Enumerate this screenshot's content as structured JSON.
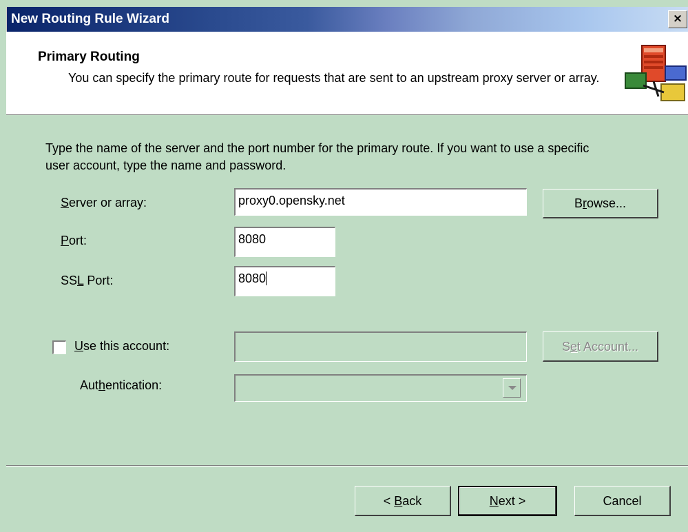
{
  "window": {
    "title": "New Routing Rule Wizard",
    "close_label": "×"
  },
  "header": {
    "title": "Primary Routing",
    "subtitle": "You can specify the primary route for requests that are sent to an upstream proxy server or array."
  },
  "instructions": "Type the name of the server and the port number for the primary route. If you want to use a specific user account, type the name and password.",
  "fields": {
    "server": {
      "label_accel": "S",
      "label_rest": "erver or array:",
      "value": "proxy0.opensky.net"
    },
    "port": {
      "label_accel": "P",
      "label_rest": "ort:",
      "value": "8080"
    },
    "ssl_port": {
      "label_pre": "SS",
      "label_accel": "L",
      "label_rest": " Port:",
      "value": "8080"
    }
  },
  "account": {
    "checkbox_accel": "U",
    "checkbox_rest": "se this account:",
    "checked": false,
    "value": "",
    "set_account_pre": "S",
    "set_account_accel": "e",
    "set_account_rest": "t Account..."
  },
  "authentication": {
    "label_pre": "Aut",
    "label_accel": "h",
    "label_rest": "entication:",
    "value": ""
  },
  "buttons": {
    "browse_pre": "B",
    "browse_accel": "r",
    "browse_rest": "owse...",
    "back_pre": "< ",
    "back_accel": "B",
    "back_rest": "ack",
    "next_accel": "N",
    "next_rest": "ext >",
    "cancel": "Cancel"
  },
  "icon": "server-network-icon"
}
